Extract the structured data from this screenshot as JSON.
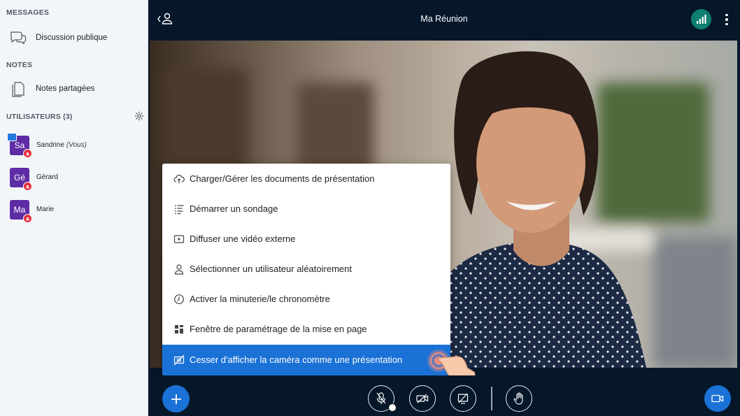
{
  "sidebar": {
    "messages_title": "MESSAGES",
    "public_chat_label": "Discussion publique",
    "notes_title": "NOTES",
    "shared_notes_label": "Notes partagées",
    "users_title": "UTILISATEURS (3)",
    "users": [
      {
        "initials": "Sa",
        "name": "Sandrine",
        "suffix": "(Vous)",
        "presenter": true
      },
      {
        "initials": "Gé",
        "name": "Gérard",
        "suffix": "",
        "presenter": false
      },
      {
        "initials": "Ma",
        "name": "Marie",
        "suffix": "",
        "presenter": false
      }
    ]
  },
  "header": {
    "title": "Ma Réunion"
  },
  "actions_menu": {
    "items": [
      {
        "label": "Charger/Gérer les documents de présentation",
        "icon": "upload-cloud-icon"
      },
      {
        "label": "Démarrer un sondage",
        "icon": "poll-list-icon"
      },
      {
        "label": "Diffuser une vidéo externe",
        "icon": "external-video-icon"
      },
      {
        "label": "Sélectionner un utilisateur aléatoirement",
        "icon": "user-icon"
      },
      {
        "label": "Activer la minuterie/le chronomètre",
        "icon": "timer-icon"
      },
      {
        "label": "Fenêtre de paramétrage de la mise en page",
        "icon": "layout-grid-icon"
      },
      {
        "label": "Cesser d'afficher la caméra comme une présentation",
        "icon": "camera-presentation-off-icon"
      }
    ]
  },
  "colors": {
    "accent": "#1B72D6",
    "dark_bg": "#06172A",
    "avatar": "#5E2CA5",
    "badge": "#DE2D3A",
    "connection": "#0F7F70"
  }
}
